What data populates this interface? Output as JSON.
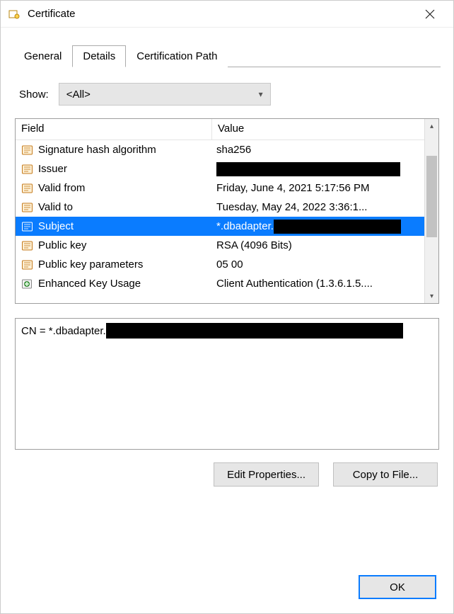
{
  "title": "Certificate",
  "tabs": {
    "general": "General",
    "details": "Details",
    "certpath": "Certification Path"
  },
  "show": {
    "label": "Show:",
    "value": "<All>"
  },
  "columns": {
    "field": "Field",
    "value": "Value"
  },
  "rows": [
    {
      "field": "Signature hash algorithm",
      "value": "sha256",
      "redacted": false,
      "iconType": "prop"
    },
    {
      "field": "Issuer",
      "value": "",
      "redacted": true,
      "iconType": "prop"
    },
    {
      "field": "Valid from",
      "value": "Friday, June 4, 2021 5:17:56 PM",
      "redacted": false,
      "iconType": "prop"
    },
    {
      "field": "Valid to",
      "value": "Tuesday, May 24, 2022 3:36:1...",
      "redacted": false,
      "iconType": "prop"
    },
    {
      "field": "Subject",
      "value": "*.dbadapter.",
      "redacted": true,
      "selected": true,
      "iconType": "prop"
    },
    {
      "field": "Public key",
      "value": "RSA (4096 Bits)",
      "redacted": false,
      "iconType": "prop"
    },
    {
      "field": "Public key parameters",
      "value": "05 00",
      "redacted": false,
      "iconType": "prop"
    },
    {
      "field": "Enhanced Key Usage",
      "value": "Client Authentication (1.3.6.1.5....",
      "redacted": false,
      "iconType": "ext"
    }
  ],
  "detail": {
    "prefix": "CN = *.dbadapter."
  },
  "buttons": {
    "edit": "Edit Properties...",
    "copy": "Copy to File...",
    "ok": "OK"
  }
}
